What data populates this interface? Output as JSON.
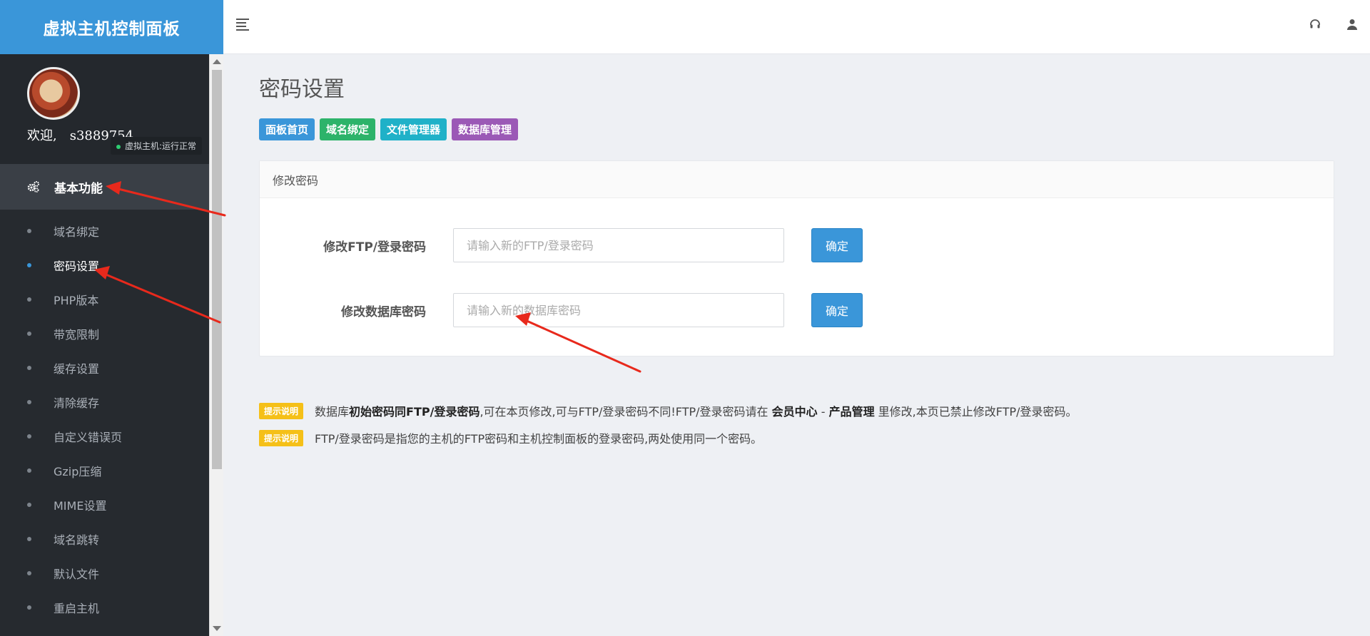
{
  "app": {
    "brand": "虚拟主机控制面板"
  },
  "topbar": {
    "icons": [
      "menu-icon",
      "headset-icon",
      "user-icon"
    ]
  },
  "user": {
    "welcome": "欢迎,",
    "username": "s3889754",
    "status": "虚拟主机:运行正常"
  },
  "sidebar": {
    "section": "基本功能",
    "items": [
      {
        "label": "域名绑定",
        "active": false
      },
      {
        "label": "密码设置",
        "active": true
      },
      {
        "label": "PHP版本",
        "active": false
      },
      {
        "label": "带宽限制",
        "active": false
      },
      {
        "label": "缓存设置",
        "active": false
      },
      {
        "label": "清除缓存",
        "active": false
      },
      {
        "label": "自定义错误页",
        "active": false
      },
      {
        "label": "Gzip压缩",
        "active": false
      },
      {
        "label": "MIME设置",
        "active": false
      },
      {
        "label": "域名跳转",
        "active": false
      },
      {
        "label": "默认文件",
        "active": false
      },
      {
        "label": "重启主机",
        "active": false
      }
    ]
  },
  "main": {
    "title": "密码设置",
    "quick_links": [
      {
        "label": "面板首页",
        "color": "#3a96d9"
      },
      {
        "label": "域名绑定",
        "color": "#2db36a"
      },
      {
        "label": "文件管理器",
        "color": "#1fb1c8"
      },
      {
        "label": "数据库管理",
        "color": "#9b59b6"
      }
    ],
    "panel": {
      "title": "修改密码",
      "ftp": {
        "label": "修改FTP/登录密码",
        "placeholder": "请输入新的FTP/登录密码",
        "button": "确定"
      },
      "db": {
        "label": "修改数据库密码",
        "placeholder": "请输入新的数据库密码",
        "button": "确定"
      }
    },
    "notes": {
      "badge": "提示说明",
      "note1": {
        "t1": "数据库",
        "b1": "初始密码同FTP/登录密码",
        "t2": ",可在本页修改,可与FTP/登录密码不同!FTP/登录密码请在 ",
        "b2": "会员中心",
        "t3": " - ",
        "b3": "产品管理",
        "t4": " 里修改,本页已禁止修改FTP/登录密码。"
      },
      "note2": "FTP/登录密码是指您的主机的FTP密码和主机控制面板的登录密码,两处使用同一个密码。"
    }
  },
  "colors": {
    "brand": "#3a96d9",
    "sidebar": "#262a2f",
    "badge": "#f5c018",
    "annotation": "#e8291c"
  }
}
